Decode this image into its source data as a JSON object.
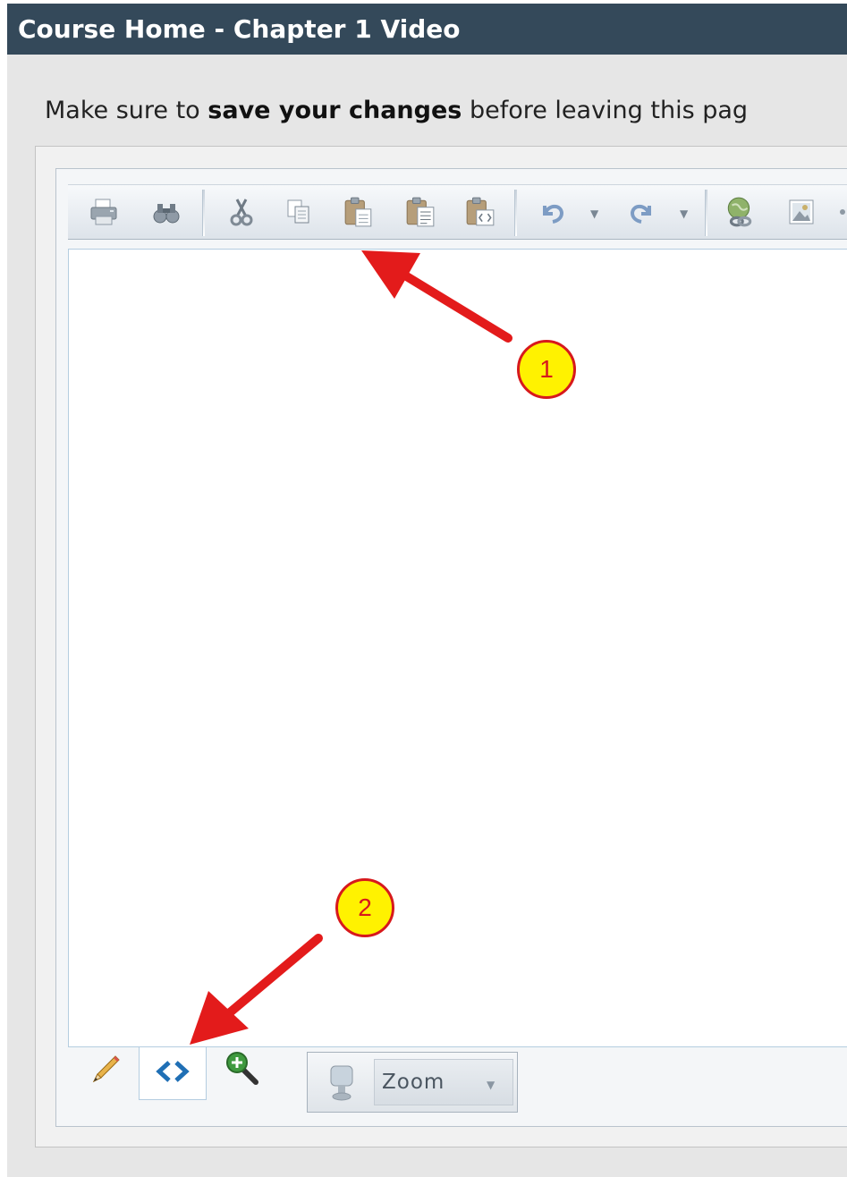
{
  "window": {
    "title": "Course Home - Chapter 1 Video"
  },
  "notice": {
    "prefix": "Make sure to ",
    "emphasis": "save your changes",
    "suffix": " before leaving this pag"
  },
  "editor": {
    "toolbar": {
      "buttons": [
        "print-icon",
        "find-icon",
        "cut-icon",
        "copy-icon",
        "paste-icon",
        "paste-text-icon",
        "paste-html-icon",
        "undo-icon",
        "redo-icon",
        "hyperlink-icon",
        "image-icon"
      ]
    },
    "modes": [
      {
        "name": "design-mode",
        "icon": "pencil-icon"
      },
      {
        "name": "html-mode",
        "icon": "code-brackets-icon",
        "active": true
      },
      {
        "name": "preview-mode",
        "icon": "zoom-in-icon"
      }
    ],
    "zoom": {
      "label": "Zoom"
    }
  },
  "annotations": [
    {
      "number": "1",
      "target": "editor toolbar"
    },
    {
      "number": "2",
      "target": "html-mode tab"
    }
  ],
  "colors": {
    "titlebar": "#34495a",
    "callout_fill": "#fff200",
    "callout_border": "#d7191c",
    "arrow": "#e31b1b"
  }
}
